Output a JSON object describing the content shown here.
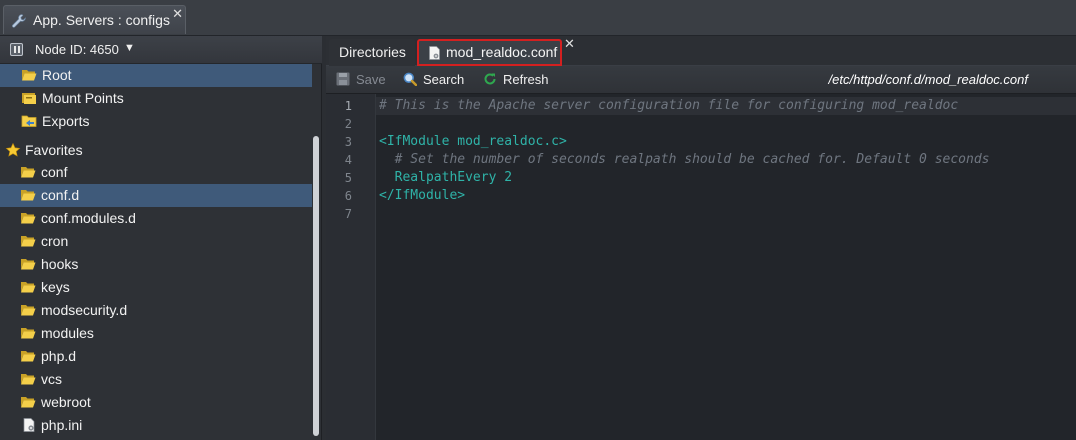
{
  "window_tab": {
    "title": "App. Servers : configs",
    "close": "✕",
    "icon": "wrench-icon"
  },
  "node": {
    "label": "Node ID: 4650",
    "caret": "▼"
  },
  "tree": {
    "items": [
      {
        "label": "Root",
        "icon": "folder-open-icon",
        "selected": true
      },
      {
        "label": "Mount Points",
        "icon": "folder-stack-icon"
      },
      {
        "label": "Exports",
        "icon": "folder-export-icon"
      },
      {
        "label": "Favorites",
        "icon": "star-icon"
      },
      {
        "label": "conf",
        "icon": "folder-icon"
      },
      {
        "label": "conf.d",
        "icon": "folder-icon",
        "selected": true
      },
      {
        "label": "conf.modules.d",
        "icon": "folder-icon"
      },
      {
        "label": "cron",
        "icon": "folder-icon"
      },
      {
        "label": "hooks",
        "icon": "folder-icon"
      },
      {
        "label": "keys",
        "icon": "folder-icon"
      },
      {
        "label": "modsecurity.d",
        "icon": "folder-icon"
      },
      {
        "label": "modules",
        "icon": "folder-icon"
      },
      {
        "label": "php.d",
        "icon": "folder-icon"
      },
      {
        "label": "vcs",
        "icon": "folder-icon"
      },
      {
        "label": "webroot",
        "icon": "folder-icon"
      },
      {
        "label": "php.ini",
        "icon": "file-gear-icon"
      }
    ]
  },
  "doc_tabs": {
    "directories": "Directories",
    "file": "mod_realdoc.conf",
    "close": "✕"
  },
  "toolbar": {
    "save": "Save",
    "search": "Search",
    "refresh": "Refresh",
    "path": "/etc/httpd/conf.d/mod_realdoc.conf"
  },
  "editor": {
    "line_numbers": [
      "1",
      "2",
      "3",
      "4",
      "5",
      "6",
      "7"
    ],
    "lines": [
      "# This is the Apache server configuration file for configuring mod_realdoc",
      "",
      "<IfModule mod_realdoc.c>",
      "  # Set the number of seconds realpath should be cached for. Default 0 seconds",
      "  RealpathEvery 2",
      "</IfModule>",
      ""
    ]
  },
  "colors": {
    "selection": "#3f5a7a",
    "tag": "#2fb3a8",
    "comment": "#6f7680",
    "highlight_border": "#d42020"
  }
}
